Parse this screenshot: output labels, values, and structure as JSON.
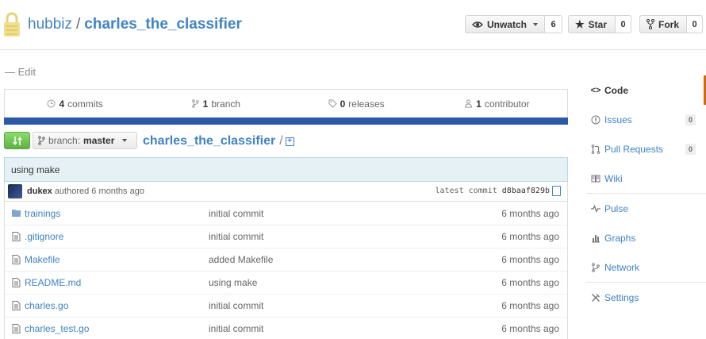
{
  "repo": {
    "owner": "hubbiz",
    "name": "charles_the_classifier"
  },
  "actions": {
    "watch": {
      "label": "Unwatch",
      "count": "6"
    },
    "star": {
      "label": "Star",
      "count": "0"
    },
    "fork": {
      "label": "Fork",
      "count": "0"
    }
  },
  "description": {
    "edit_label": "— Edit"
  },
  "summary": {
    "commits": {
      "count": "4",
      "label": "commits"
    },
    "branches": {
      "count": "1",
      "label": "branch"
    },
    "releases": {
      "count": "0",
      "label": "releases"
    },
    "contributors": {
      "count": "1",
      "label": "contributor"
    },
    "bar_color": "#2b58a8"
  },
  "branch": {
    "prefix": "branch:",
    "name": "master"
  },
  "breadcrumb": {
    "repo": "charles_the_classifier",
    "separator": "/"
  },
  "commit": {
    "message": "using make",
    "author": "dukex",
    "authored": "authored 6 months ago",
    "latest_label": "latest commit",
    "sha": "d8baaf829b"
  },
  "files": [
    {
      "type": "folder",
      "name": "trainings",
      "message": "initial commit",
      "age": "6 months ago"
    },
    {
      "type": "file",
      "name": ".gitignore",
      "message": "initial commit",
      "age": "6 months ago"
    },
    {
      "type": "file",
      "name": "Makefile",
      "message": "added Makefile",
      "age": "6 months ago"
    },
    {
      "type": "file",
      "name": "README.md",
      "message": "using make",
      "age": "6 months ago"
    },
    {
      "type": "file",
      "name": "charles.go",
      "message": "initial commit",
      "age": "6 months ago"
    },
    {
      "type": "file",
      "name": "charles_test.go",
      "message": "initial commit",
      "age": "6 months ago"
    }
  ],
  "sidebar": {
    "code": "Code",
    "issues": {
      "label": "Issues",
      "count": "0"
    },
    "pulls": {
      "label": "Pull Requests",
      "count": "0"
    },
    "wiki": "Wiki",
    "pulse": "Pulse",
    "graphs": "Graphs",
    "network": "Network",
    "settings": "Settings"
  }
}
